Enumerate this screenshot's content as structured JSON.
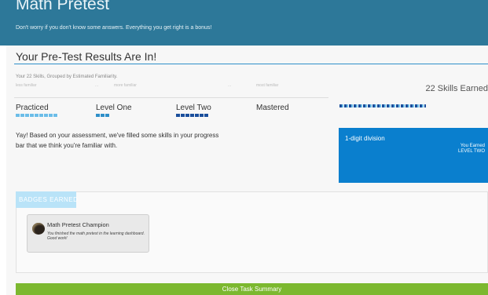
{
  "header": {
    "title": "Math Pretest",
    "subtitle": "Don't worry if you don't know some answers. Everything you get right is a bonus!"
  },
  "results": {
    "title": "Your Pre-Test Results Are In!",
    "group_caption": "Your 22 Skills, Grouped by Estimated Familiarity.",
    "familiarity_scale": [
      "less familiar",
      "...",
      "more familiar",
      "...",
      "most familiar"
    ],
    "skills_earned": "22 Skills Earned",
    "levels": [
      "Practiced",
      "Level One",
      "Level Two",
      "Mastered"
    ],
    "message": "Yay! Based on your assessment, we've filled some skills in your progress bar that we think you're familiar with."
  },
  "skill_card": {
    "name": "1-digit division",
    "earned_label": "You Earned",
    "earned_level": "LEVEL TWO"
  },
  "badges": {
    "tab_label": "BADGES EARNED",
    "items": [
      {
        "title": "Math Pretest Champion",
        "description": "You finished the math pretest in the learning dashboard. Good work!",
        "icon": "badge-medal-icon"
      }
    ]
  },
  "close_button": "Close Task Summary",
  "colors": {
    "header": "#2d7899",
    "accent": "#2e8fc9",
    "skill_card": "#0a7fce",
    "badge_tab": "#b9e3f8",
    "close_button": "#7cb82f"
  }
}
